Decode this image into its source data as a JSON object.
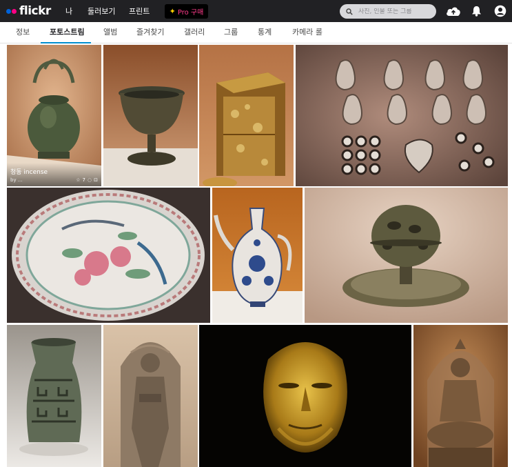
{
  "brand": {
    "name": "flickr"
  },
  "topnav": {
    "you": "나",
    "explore": "둘러보기",
    "prints": "프린트"
  },
  "pro": {
    "label": "Pro 구매"
  },
  "search": {
    "placeholder": "사진, 인물 또는 그룹"
  },
  "subnav": {
    "tabs": [
      {
        "label": "정보"
      },
      {
        "label": "포토스트림",
        "active": true
      },
      {
        "label": "앨범"
      },
      {
        "label": "즐겨찾기"
      },
      {
        "label": "갤러리"
      },
      {
        "label": "그룹"
      },
      {
        "label": "통계"
      },
      {
        "label": "카메라 롤"
      }
    ]
  },
  "photos": [
    {
      "subject": "bronze kettle",
      "overlay": {
        "title": "청동 incense",
        "author": "by ...",
        "faves": "7",
        "comments": ""
      }
    },
    {
      "subject": "bronze goblet"
    },
    {
      "subject": "gold lacquer box"
    },
    {
      "subject": "silver ornaments"
    },
    {
      "subject": "famille rose plate"
    },
    {
      "subject": "blue and white ewer"
    },
    {
      "subject": "bronze censer"
    },
    {
      "subject": "bronze vessel"
    },
    {
      "subject": "stone relief"
    },
    {
      "subject": "gold mask"
    },
    {
      "subject": "seated bodhisattva"
    }
  ],
  "colors": {
    "topbar": "#212124",
    "accent": "#008ecf",
    "flickr_blue": "#0063dc",
    "flickr_pink": "#ff0084"
  }
}
